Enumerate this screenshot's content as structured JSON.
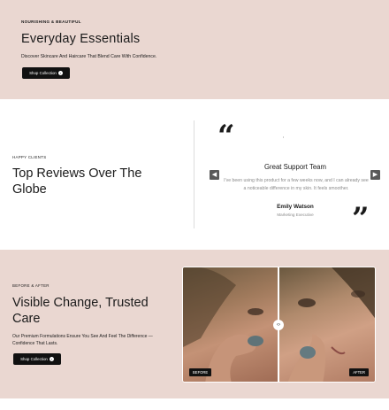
{
  "hero": {
    "eyebrow": "NOURISHING & BEAUTIFUL",
    "title": "Everyday Essentials",
    "subtitle": "Discover Skincare And Haircare That Blend Care With Confidence.",
    "button_label": "Shop Collection"
  },
  "reviews": {
    "eyebrow": "HAPPY CLIENTS",
    "title": "Top Reviews Over The Globe",
    "item": {
      "heading": "Great Support Team",
      "body": "I've been using this product for a few weeks now, and I can already see a noticeable difference in my skin. It feels smoother.",
      "name": "Emily Watson",
      "role": "Marketing Executive"
    },
    "icons": {
      "prev": "chevron-left-icon",
      "next": "chevron-right-icon",
      "quote": "quote-icon"
    }
  },
  "before_after": {
    "eyebrow": "BEFORE & AFTER",
    "title": "Visible Change, Trusted Care",
    "subtitle": "Our Premium Formulations Ensure You See And Feel The Difference — Confidence That Lasts.",
    "button_label": "Shop Collection",
    "before_label": "BEFORE",
    "after_label": "AFTER",
    "handle_glyph": "‹›"
  },
  "colors": {
    "blush": "#ead7d1",
    "dark": "#111111"
  }
}
